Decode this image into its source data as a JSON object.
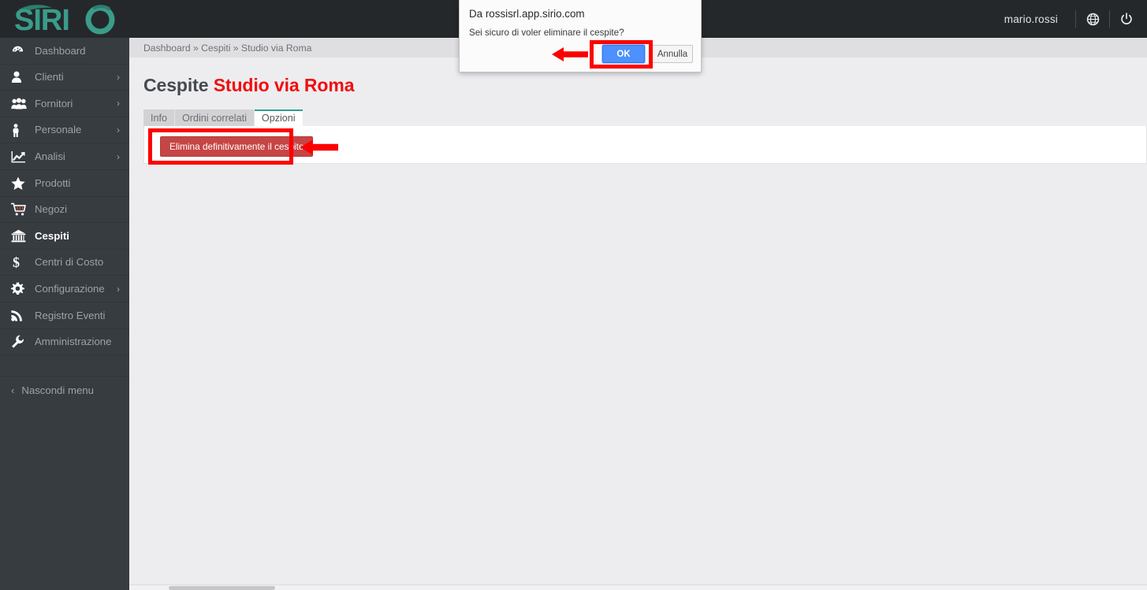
{
  "app": {
    "brand": "SIRIO",
    "brand_color": "#3a9c8a"
  },
  "topbar": {
    "username": "mario.rossi",
    "language_icon": "globe-icon",
    "logout_icon": "power-icon"
  },
  "sidebar": {
    "items": [
      {
        "label": "Dashboard",
        "icon": "dashboard-icon",
        "has_submenu": false,
        "active": false
      },
      {
        "label": "Clienti",
        "icon": "user-icon",
        "has_submenu": true,
        "active": false
      },
      {
        "label": "Fornitori",
        "icon": "users-group-icon",
        "has_submenu": true,
        "active": false
      },
      {
        "label": "Personale",
        "icon": "person-icon",
        "has_submenu": true,
        "active": false
      },
      {
        "label": "Analisi",
        "icon": "line-chart-icon",
        "has_submenu": true,
        "active": false
      },
      {
        "label": "Prodotti",
        "icon": "star-icon",
        "has_submenu": false,
        "active": false
      },
      {
        "label": "Negozi",
        "icon": "shopping-cart-icon",
        "has_submenu": false,
        "active": false
      },
      {
        "label": "Cespiti",
        "icon": "bank-icon",
        "has_submenu": false,
        "active": true
      },
      {
        "label": "Centri di Costo",
        "icon": "dollar-icon",
        "has_submenu": false,
        "active": false
      },
      {
        "label": "Configurazione",
        "icon": "gear-icon",
        "has_submenu": true,
        "active": false
      },
      {
        "label": "Registro Eventi",
        "icon": "rss-icon",
        "has_submenu": false,
        "active": false
      },
      {
        "label": "Amministrazione",
        "icon": "wrench-icon",
        "has_submenu": false,
        "active": false
      }
    ],
    "collapse_label": "Nascondi menu",
    "collapse_icon": "chevron-left-icon",
    "caret_icon": "chevron-right-icon"
  },
  "main": {
    "breadcrumb": "Dashboard » Cespiti » Studio via Roma",
    "title_prefix": "Cespite",
    "title_highlight": "Studio via Roma",
    "tabs": [
      {
        "label": "Info",
        "active": false
      },
      {
        "label": "Ordini correlati",
        "active": false
      },
      {
        "label": "Opzioni",
        "active": true
      }
    ],
    "delete_button_label": "Elimina definitivamente il cespite"
  },
  "dialog": {
    "title": "Da rossisrl.app.sirio.com",
    "message": "Sei sicuro di voler eliminare il cespite?",
    "ok_label": "OK",
    "cancel_label": "Annulla"
  },
  "annotations": {
    "highlight_color": "#fc0000",
    "arrow_icon": "left-arrow-icon"
  }
}
